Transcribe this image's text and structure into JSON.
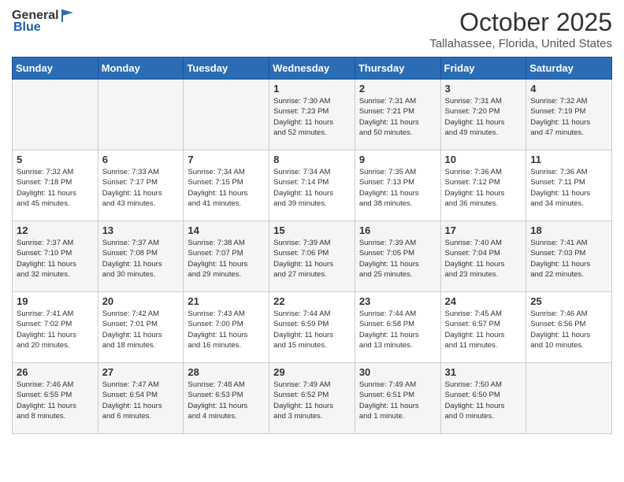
{
  "header": {
    "logo_general": "General",
    "logo_blue": "Blue",
    "month": "October 2025",
    "location": "Tallahassee, Florida, United States"
  },
  "days_of_week": [
    "Sunday",
    "Monday",
    "Tuesday",
    "Wednesday",
    "Thursday",
    "Friday",
    "Saturday"
  ],
  "weeks": [
    [
      {
        "day": "",
        "info": ""
      },
      {
        "day": "",
        "info": ""
      },
      {
        "day": "",
        "info": ""
      },
      {
        "day": "1",
        "info": "Sunrise: 7:30 AM\nSunset: 7:23 PM\nDaylight: 11 hours\nand 52 minutes."
      },
      {
        "day": "2",
        "info": "Sunrise: 7:31 AM\nSunset: 7:21 PM\nDaylight: 11 hours\nand 50 minutes."
      },
      {
        "day": "3",
        "info": "Sunrise: 7:31 AM\nSunset: 7:20 PM\nDaylight: 11 hours\nand 49 minutes."
      },
      {
        "day": "4",
        "info": "Sunrise: 7:32 AM\nSunset: 7:19 PM\nDaylight: 11 hours\nand 47 minutes."
      }
    ],
    [
      {
        "day": "5",
        "info": "Sunrise: 7:32 AM\nSunset: 7:18 PM\nDaylight: 11 hours\nand 45 minutes."
      },
      {
        "day": "6",
        "info": "Sunrise: 7:33 AM\nSunset: 7:17 PM\nDaylight: 11 hours\nand 43 minutes."
      },
      {
        "day": "7",
        "info": "Sunrise: 7:34 AM\nSunset: 7:15 PM\nDaylight: 11 hours\nand 41 minutes."
      },
      {
        "day": "8",
        "info": "Sunrise: 7:34 AM\nSunset: 7:14 PM\nDaylight: 11 hours\nand 39 minutes."
      },
      {
        "day": "9",
        "info": "Sunrise: 7:35 AM\nSunset: 7:13 PM\nDaylight: 11 hours\nand 38 minutes."
      },
      {
        "day": "10",
        "info": "Sunrise: 7:36 AM\nSunset: 7:12 PM\nDaylight: 11 hours\nand 36 minutes."
      },
      {
        "day": "11",
        "info": "Sunrise: 7:36 AM\nSunset: 7:11 PM\nDaylight: 11 hours\nand 34 minutes."
      }
    ],
    [
      {
        "day": "12",
        "info": "Sunrise: 7:37 AM\nSunset: 7:10 PM\nDaylight: 11 hours\nand 32 minutes."
      },
      {
        "day": "13",
        "info": "Sunrise: 7:37 AM\nSunset: 7:08 PM\nDaylight: 11 hours\nand 30 minutes."
      },
      {
        "day": "14",
        "info": "Sunrise: 7:38 AM\nSunset: 7:07 PM\nDaylight: 11 hours\nand 29 minutes."
      },
      {
        "day": "15",
        "info": "Sunrise: 7:39 AM\nSunset: 7:06 PM\nDaylight: 11 hours\nand 27 minutes."
      },
      {
        "day": "16",
        "info": "Sunrise: 7:39 AM\nSunset: 7:05 PM\nDaylight: 11 hours\nand 25 minutes."
      },
      {
        "day": "17",
        "info": "Sunrise: 7:40 AM\nSunset: 7:04 PM\nDaylight: 11 hours\nand 23 minutes."
      },
      {
        "day": "18",
        "info": "Sunrise: 7:41 AM\nSunset: 7:03 PM\nDaylight: 11 hours\nand 22 minutes."
      }
    ],
    [
      {
        "day": "19",
        "info": "Sunrise: 7:41 AM\nSunset: 7:02 PM\nDaylight: 11 hours\nand 20 minutes."
      },
      {
        "day": "20",
        "info": "Sunrise: 7:42 AM\nSunset: 7:01 PM\nDaylight: 11 hours\nand 18 minutes."
      },
      {
        "day": "21",
        "info": "Sunrise: 7:43 AM\nSunset: 7:00 PM\nDaylight: 11 hours\nand 16 minutes."
      },
      {
        "day": "22",
        "info": "Sunrise: 7:44 AM\nSunset: 6:59 PM\nDaylight: 11 hours\nand 15 minutes."
      },
      {
        "day": "23",
        "info": "Sunrise: 7:44 AM\nSunset: 6:58 PM\nDaylight: 11 hours\nand 13 minutes."
      },
      {
        "day": "24",
        "info": "Sunrise: 7:45 AM\nSunset: 6:57 PM\nDaylight: 11 hours\nand 11 minutes."
      },
      {
        "day": "25",
        "info": "Sunrise: 7:46 AM\nSunset: 6:56 PM\nDaylight: 11 hours\nand 10 minutes."
      }
    ],
    [
      {
        "day": "26",
        "info": "Sunrise: 7:46 AM\nSunset: 6:55 PM\nDaylight: 11 hours\nand 8 minutes."
      },
      {
        "day": "27",
        "info": "Sunrise: 7:47 AM\nSunset: 6:54 PM\nDaylight: 11 hours\nand 6 minutes."
      },
      {
        "day": "28",
        "info": "Sunrise: 7:48 AM\nSunset: 6:53 PM\nDaylight: 11 hours\nand 4 minutes."
      },
      {
        "day": "29",
        "info": "Sunrise: 7:49 AM\nSunset: 6:52 PM\nDaylight: 11 hours\nand 3 minutes."
      },
      {
        "day": "30",
        "info": "Sunrise: 7:49 AM\nSunset: 6:51 PM\nDaylight: 11 hours\nand 1 minute."
      },
      {
        "day": "31",
        "info": "Sunrise: 7:50 AM\nSunset: 6:50 PM\nDaylight: 11 hours\nand 0 minutes."
      },
      {
        "day": "",
        "info": ""
      }
    ]
  ]
}
